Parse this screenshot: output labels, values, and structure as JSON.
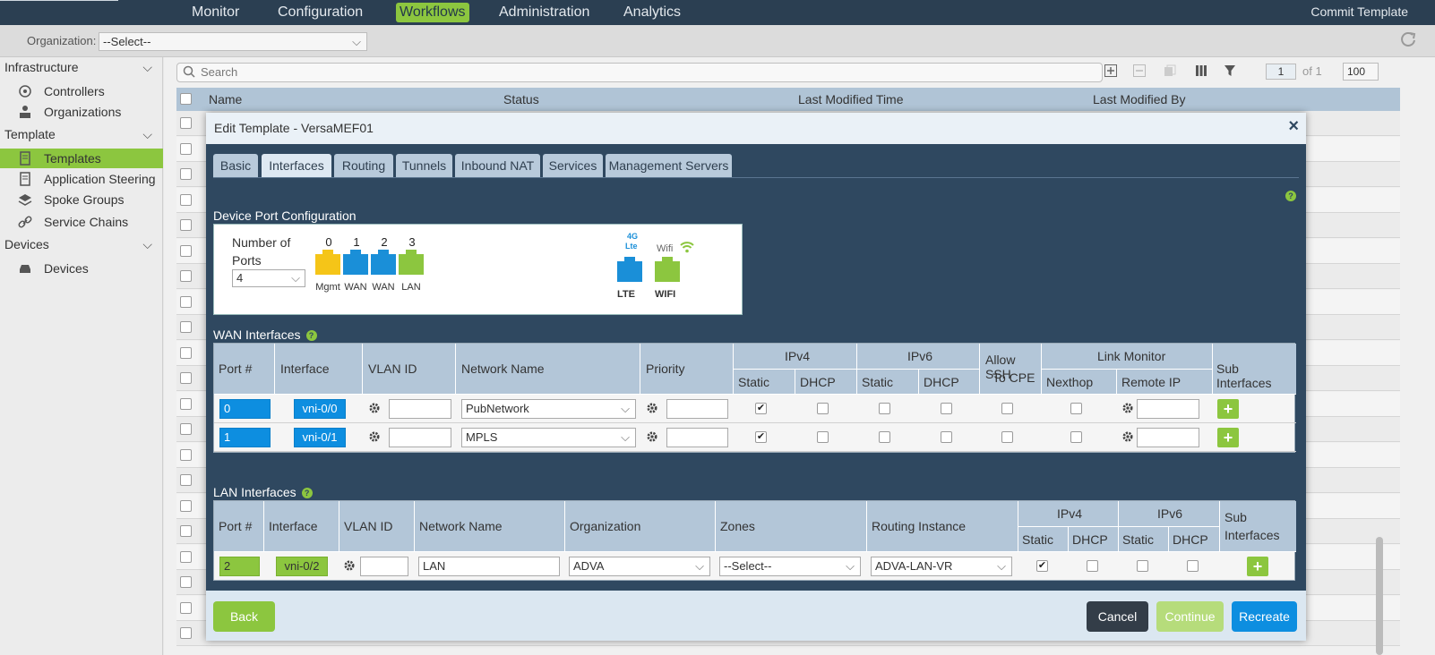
{
  "topnav": {
    "items": [
      "Monitor",
      "Configuration",
      "Workflows",
      "Administration",
      "Analytics"
    ],
    "active": "Workflows",
    "commit": "Commit Template"
  },
  "orgbar": {
    "label": "Organization:",
    "value": "--Select--"
  },
  "sidebar": {
    "sections": {
      "infrastructure": "Infrastructure",
      "template": "Template",
      "devices": "Devices"
    },
    "items": {
      "controllers": "Controllers",
      "organizations": "Organizations",
      "templates": "Templates",
      "app_steering": "Application Steering",
      "spoke_groups": "Spoke Groups",
      "service_chains": "Service Chains",
      "devices": "Devices"
    }
  },
  "list": {
    "search_placeholder": "Search",
    "page": "1",
    "of_label": "of 1",
    "page_size": "100",
    "columns": [
      "Name",
      "Status",
      "Last Modified Time",
      "Last Modified By"
    ]
  },
  "modal": {
    "title": "Edit Template - VersaMEF01",
    "close": "×",
    "tabs": [
      "Basic",
      "Interfaces",
      "Routing",
      "Tunnels",
      "Inbound NAT",
      "Services",
      "Management Servers"
    ],
    "active_tab": "Interfaces",
    "help": "?",
    "device_port_title": "Device Port Configuration",
    "ports_label_line1": "Number of",
    "ports_label_line2": "Ports",
    "ports_count": "4",
    "ports": [
      {
        "num": "0",
        "label": "Mgmt",
        "color": "#f5c518"
      },
      {
        "num": "1",
        "label": "WAN",
        "color": "#1a8fd8"
      },
      {
        "num": "2",
        "label": "WAN",
        "color": "#1a8fd8"
      },
      {
        "num": "3",
        "label": "LAN",
        "color": "#8cc63f"
      }
    ],
    "lte": {
      "badge_top": "4G",
      "badge": "Lte",
      "label": "LTE",
      "color": "#1a8fd8"
    },
    "wifi": {
      "badge": "Wifi",
      "label": "WIFI",
      "color": "#8cc63f"
    },
    "wan": {
      "title": "WAN Interfaces",
      "headers": {
        "port": "Port #",
        "interface": "Interface",
        "vlan": "VLAN ID",
        "network": "Network Name",
        "priority": "Priority",
        "ipv4": "IPv4",
        "ipv6": "IPv6",
        "static": "Static",
        "dhcp": "DHCP",
        "ssh1": "Allow SSH",
        "ssh2": "To CPE",
        "link_monitor": "Link Monitor",
        "nexthop": "Nexthop",
        "remote_ip": "Remote IP",
        "sub": "Sub Interfaces"
      },
      "rows": [
        {
          "port": "0",
          "interface": "vni-0/0",
          "network": "PubNetwork",
          "ipv4_static": true
        },
        {
          "port": "1",
          "interface": "vni-0/1",
          "network": "MPLS",
          "ipv4_static": true
        }
      ]
    },
    "lan": {
      "title": "LAN Interfaces",
      "headers": {
        "port": "Port #",
        "interface": "Interface",
        "vlan": "VLAN ID",
        "network": "Network Name",
        "org": "Organization",
        "zones": "Zones",
        "routing": "Routing Instance",
        "ipv4": "IPv4",
        "ipv6": "IPv6",
        "static": "Static",
        "dhcp": "DHCP",
        "sub1": "Sub",
        "sub2": "Interfaces"
      },
      "rows": [
        {
          "port": "2",
          "interface": "vni-0/2",
          "network": "LAN",
          "org": "ADVA",
          "zones": "--Select--",
          "routing": "ADVA-LAN-VR",
          "ipv4_static": true
        }
      ]
    },
    "buttons": {
      "back": "Back",
      "cancel": "Cancel",
      "continue": "Continue",
      "recreate": "Recreate"
    },
    "check": "✔",
    "plus": "+",
    "chevron": "⌵"
  }
}
